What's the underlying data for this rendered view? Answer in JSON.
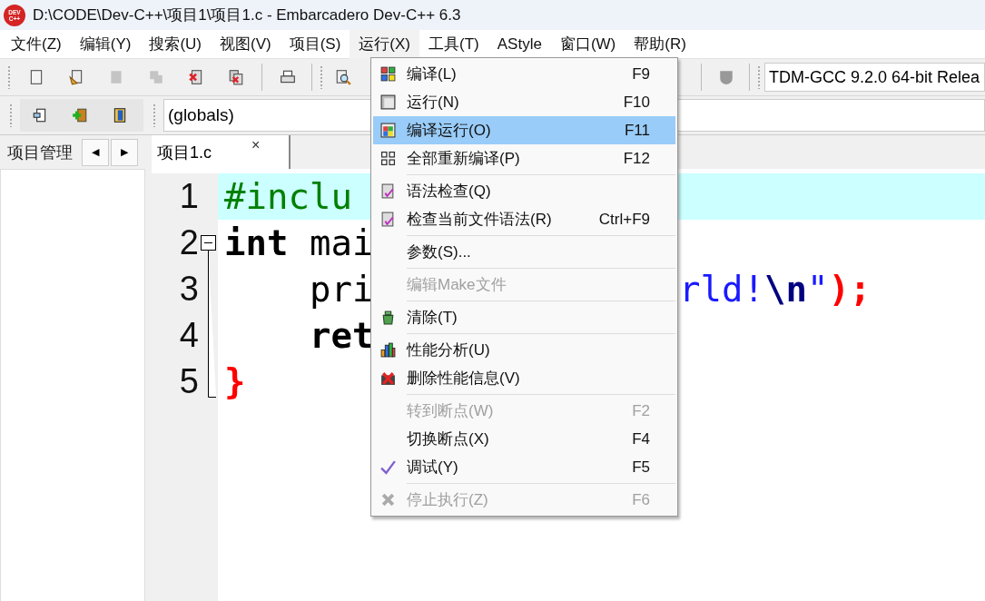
{
  "window": {
    "logo_lines": [
      "DEV",
      "C++"
    ],
    "title": "D:\\CODE\\Dev-C++\\项目1\\项目1.c - Embarcadero Dev-C++ 6.3"
  },
  "menubar": [
    {
      "label": "文件(Z)",
      "selected": false
    },
    {
      "label": "编辑(Y)",
      "selected": false
    },
    {
      "label": "搜索(U)",
      "selected": false
    },
    {
      "label": "视图(V)",
      "selected": false
    },
    {
      "label": "项目(S)",
      "selected": false
    },
    {
      "label": "运行(X)",
      "selected": true
    },
    {
      "label": "工具(T)",
      "selected": false
    },
    {
      "label": "AStyle",
      "selected": false
    },
    {
      "label": "窗口(W)",
      "selected": false
    },
    {
      "label": "帮助(R)",
      "selected": false
    }
  ],
  "toolbar": {
    "buttons": [
      {
        "disabled": false
      },
      {
        "disabled": false
      },
      {
        "disabled": true
      },
      {
        "disabled": true
      },
      {
        "disabled": false
      },
      {
        "disabled": false
      },
      {
        "disabled": false
      },
      {
        "disabled": false
      }
    ],
    "compiler": "TDM-GCC 9.2.0 64-bit Relea"
  },
  "scope_field": "(globals)",
  "left_panel": {
    "tab": "项目管理",
    "prev": "◀",
    "next": "▶"
  },
  "editor_tab": {
    "label": "项目1.c",
    "close": "×"
  },
  "code": [
    {
      "number": "1",
      "highlighted": true,
      "parts": [
        {
          "kind": "preprocessor",
          "text": "#inclu"
        }
      ]
    },
    {
      "number": "2",
      "highlighted": false,
      "parts": [
        {
          "kind": "keyword",
          "text": "int"
        },
        {
          "kind": "plain",
          "text": " mai"
        }
      ]
    },
    {
      "number": "3",
      "highlighted": false,
      "parts": [
        {
          "kind": "plain",
          "text": "    pri"
        }
      ],
      "tail": [
        {
          "kind": "string",
          "text": "rld!"
        },
        {
          "kind": "escape",
          "text": "\\n"
        },
        {
          "kind": "string",
          "text": "\""
        },
        {
          "kind": "symbol",
          "text": ");"
        }
      ]
    },
    {
      "number": "4",
      "highlighted": false,
      "parts": [
        {
          "kind": "keyword",
          "text": "    ret"
        }
      ]
    },
    {
      "number": "5",
      "highlighted": false,
      "parts": [
        {
          "kind": "symbol",
          "text": "}"
        }
      ]
    }
  ],
  "run_menu": [
    {
      "kind": "item",
      "label": "编译(L)",
      "shortcut": "F9",
      "disabled": false,
      "selected": false
    },
    {
      "kind": "item",
      "label": "运行(N)",
      "shortcut": "F10",
      "disabled": false,
      "selected": false
    },
    {
      "kind": "item",
      "label": "编译运行(O)",
      "shortcut": "F11",
      "disabled": false,
      "selected": true
    },
    {
      "kind": "item",
      "label": "全部重新编译(P)",
      "shortcut": "F12",
      "disabled": false,
      "selected": false
    },
    {
      "kind": "separator"
    },
    {
      "kind": "item",
      "label": "语法检查(Q)",
      "disabled": false,
      "selected": false
    },
    {
      "kind": "item",
      "label": "检查当前文件语法(R)",
      "shortcut": "Ctrl+F9",
      "disabled": false,
      "selected": false
    },
    {
      "kind": "separator"
    },
    {
      "kind": "item",
      "label": "参数(S)...",
      "disabled": false,
      "selected": false
    },
    {
      "kind": "separator"
    },
    {
      "kind": "item",
      "label": "编辑Make文件",
      "disabled": true,
      "selected": false
    },
    {
      "kind": "separator"
    },
    {
      "kind": "item",
      "label": "清除(T)",
      "disabled": false,
      "selected": false
    },
    {
      "kind": "separator"
    },
    {
      "kind": "item",
      "label": "性能分析(U)",
      "disabled": false,
      "selected": false
    },
    {
      "kind": "item",
      "label": "删除性能信息(V)",
      "disabled": false,
      "selected": false
    },
    {
      "kind": "separator"
    },
    {
      "kind": "item",
      "label": "转到断点(W)",
      "shortcut": "F2",
      "disabled": true,
      "selected": false
    },
    {
      "kind": "item",
      "label": "切换断点(X)",
      "shortcut": "F4",
      "disabled": false,
      "selected": false
    },
    {
      "kind": "item",
      "label": "调试(Y)",
      "shortcut": "F5",
      "disabled": false,
      "selected": false
    },
    {
      "kind": "separator"
    },
    {
      "kind": "item",
      "label": "停止执行(Z)",
      "shortcut": "F6",
      "disabled": true,
      "selected": false
    }
  ]
}
